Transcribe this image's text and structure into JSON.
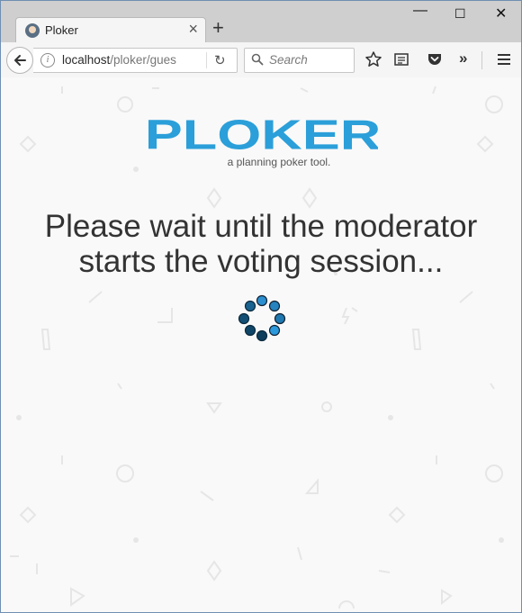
{
  "browser": {
    "tab_title": "Ploker",
    "new_tab_label": "+",
    "window_controls": {
      "minimize": "—",
      "maximize": "☐",
      "close": "✕"
    },
    "url_host": "localhost",
    "url_path": "/ploker/gues",
    "search_placeholder": "Search",
    "icons": [
      "back-icon",
      "info-icon",
      "reload-icon",
      "search-icon",
      "star-icon",
      "reader-icon",
      "pocket-icon",
      "overflow-icon",
      "menu-icon"
    ]
  },
  "page": {
    "logo_text": "PLOKER",
    "tagline": "a planning poker tool.",
    "message_line1": "Please wait until the moderator",
    "message_line2": "starts the voting session...",
    "colors": {
      "logo_blue": "#2b9fd9",
      "spinner_dark": "#0d3e5c",
      "spinner_light": "#2b8fd0",
      "background": "#f9f9f9",
      "text": "#333333"
    }
  }
}
